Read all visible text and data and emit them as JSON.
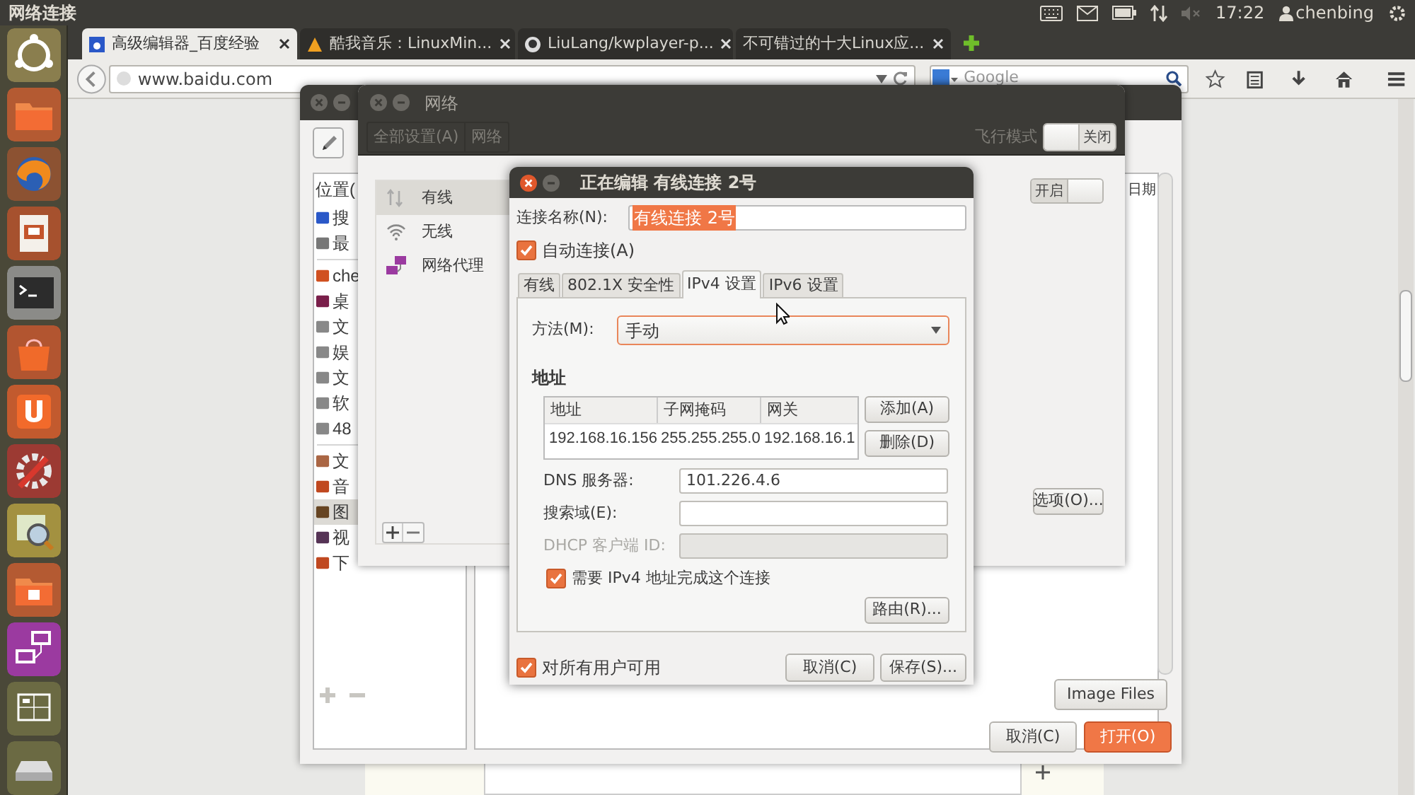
{
  "top_panel": {
    "title": "网络连接",
    "clock": "17:22",
    "user": "chenbing"
  },
  "browser": {
    "tabs": [
      {
        "title": "高级编辑器_百度经验",
        "selected": true
      },
      {
        "title": "酷我音乐：LinuxMin...",
        "selected": false
      },
      {
        "title": "LiuLang/kwplayer-p...",
        "selected": false
      },
      {
        "title": "不可错过的十大Linux应...",
        "selected": false
      }
    ],
    "url": "www.baidu.com",
    "search_placeholder": "Google"
  },
  "file_dialog": {
    "places_header": "位置(",
    "places": [
      {
        "label": "搜",
        "selected": false
      },
      {
        "label": "最",
        "selected": false
      },
      {
        "label": "che",
        "selected": false
      },
      {
        "label": "桌",
        "selected": false
      },
      {
        "label": "文",
        "selected": false
      },
      {
        "label": "娱",
        "selected": false
      },
      {
        "label": "文",
        "selected": false
      },
      {
        "label": "软",
        "selected": false
      },
      {
        "label": "48",
        "selected": false
      },
      {
        "label": "文",
        "selected": false
      },
      {
        "label": "音",
        "selected": false
      },
      {
        "label": "图",
        "selected": true
      },
      {
        "label": "视",
        "selected": false
      },
      {
        "label": "下",
        "selected": false
      }
    ],
    "date_column": "日期",
    "filter": "Image Files",
    "buttons": [
      "取消(C)",
      "打开(O)"
    ]
  },
  "network_window": {
    "title": "网络",
    "breadcrumbs": [
      "全部设置(A)",
      "网络"
    ],
    "airplane_mode": {
      "label": "飞行模式",
      "on": false,
      "state_text": "关闭"
    },
    "devices": [
      {
        "label": "有线",
        "kind": "wired",
        "selected": true
      },
      {
        "label": "无线",
        "kind": "wireless",
        "selected": false
      },
      {
        "label": "网络代理",
        "kind": "proxy",
        "selected": false
      }
    ],
    "device_switch": {
      "on": true,
      "state_text": "开启"
    },
    "options_button": "选项(O)..."
  },
  "edit_dialog": {
    "title": "正在编辑 有线连接 2号",
    "name_label": "连接名称(N):",
    "name_value": "有线连接 2号",
    "auto_connect": {
      "label": "自动连接(A)",
      "checked": true
    },
    "tabs": [
      {
        "label": "有线",
        "selected": false
      },
      {
        "label": "802.1X 安全性",
        "selected": false
      },
      {
        "label": "IPv4 设置",
        "selected": true
      },
      {
        "label": "IPv6 设置",
        "selected": false
      }
    ],
    "method_label": "方法(M):",
    "method": "手动",
    "address_heading": "地址",
    "columns": [
      "地址",
      "子网掩码",
      "网关"
    ],
    "rows": [
      [
        "192.168.16.156",
        "255.255.255.0",
        "192.168.16.1"
      ]
    ],
    "add_button": "添加(A)",
    "delete_button": "删除(D)",
    "fields": [
      {
        "label": "DNS 服务器:",
        "value": "101.226.4.6",
        "disabled": false
      },
      {
        "label": "搜索域(E):",
        "disabled": false
      },
      {
        "label": "DHCP 客户端 ID:",
        "disabled": true
      }
    ],
    "require_ipv4": {
      "label": "需要 IPv4 地址完成这个连接",
      "checked": true
    },
    "routes_button": "路由(R)...",
    "all_users": {
      "label": "对所有用户可用",
      "checked": true
    },
    "buttons": [
      "取消(C)",
      "保存(S)..."
    ]
  }
}
